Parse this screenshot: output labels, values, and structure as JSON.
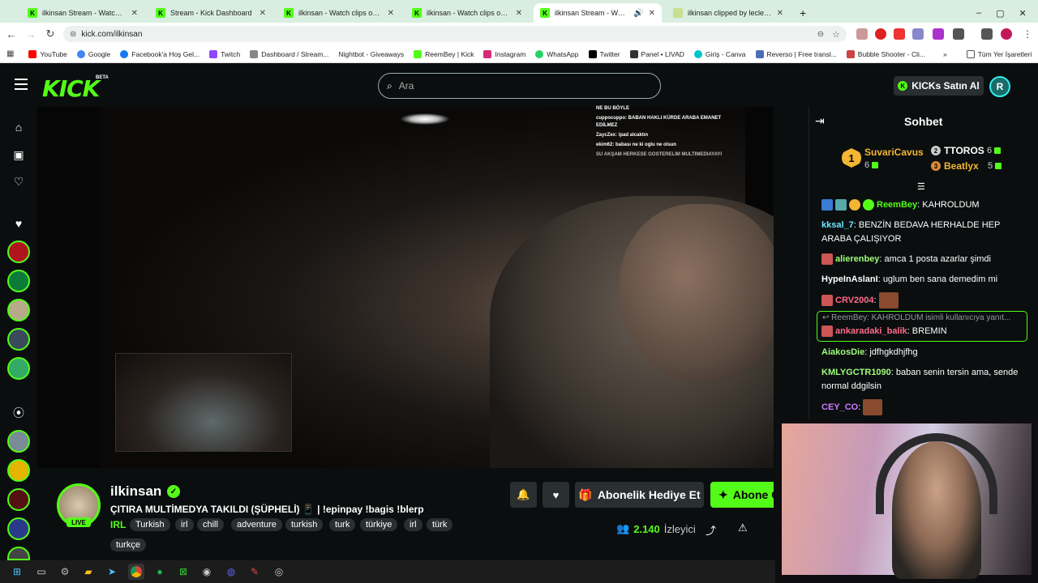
{
  "browser": {
    "tabs": [
      {
        "title": "ilkinsan Stream - Watch Live on Kick",
        "active": false
      },
      {
        "title": "Stream - Kick Dashboard",
        "active": false
      },
      {
        "title": "ilkinsan - Watch clips on Kick",
        "active": false
      },
      {
        "title": "ilkinsan - Watch clips on Kick",
        "active": false
      },
      {
        "title": "ilkinsan Stream - Watch Live on Kick",
        "active": true
      },
      {
        "title": "ilkinsan clipped by leclercurry",
        "active": false
      }
    ],
    "url": "kick.com/ilkinsan",
    "bookmarks": [
      "YouTube",
      "Google",
      "Facebook'a Hoş Gel...",
      "Twitch",
      "Dashboard / Stream...",
      "Nightbot - Giveaways",
      "ReemBey | Kick",
      "Instagram",
      "WhatsApp",
      "Twitter",
      "Panel • LIVAD",
      "Giriş - Canva",
      "Reverso | Free transl...",
      "Bubble Shooter - Cli..."
    ],
    "all_bookmarks": "Tüm Yer İşaretleri",
    "new_tab": "+",
    "chevron": "»"
  },
  "header": {
    "logo": "KICK",
    "logo_badge": "BETA",
    "search_placeholder": "Ara",
    "kicks_button": "KICKs Satın Al",
    "avatar_initial": "R"
  },
  "video_overlay_chat": [
    "NE BU BÖYLE",
    "cuppocuppo: BABAN HAKLI KÜRDE ARABA EMANET EDİLMEZ",
    "ZaycZex: ipad alcaktın",
    "ekim62: babası ne ki oglu ne olsun",
    "SU AKŞAM HERKESE GÖSTERELİM MULTİMEDİAYAYI"
  ],
  "channel": {
    "name": "ilkinsan",
    "live_label": "LIVE",
    "title": "ÇITIRA MULTİMEDYA TAKILDI (ŞÜPHELİ) 📱 | !epinpay !bagis !blerp",
    "category": "IRL",
    "tags": [
      "Turkish",
      "irl",
      "chill",
      "adventure",
      "turkish",
      "turk",
      "türkiye",
      "irl",
      "türk",
      "turkçe"
    ],
    "gift_button": "Abonelik Hediye Et",
    "subscribe_button": "Abone Ol",
    "viewer_count": "2.140",
    "viewer_label": "İzleyici"
  },
  "chat": {
    "title": "Sohbet",
    "leaderboard": [
      {
        "name": "SuvariCavus",
        "count": "6",
        "rank": "1",
        "color": "#f2b632"
      },
      {
        "name": "TTOROS",
        "count": "6",
        "rank": "2",
        "color": "#e6e6e6"
      },
      {
        "name": "Beatlyx",
        "count": "5",
        "rank": "3",
        "color": "#f2b632"
      }
    ],
    "messages": [
      {
        "user": "ReemBey",
        "text": "KAHROLDUM",
        "color": "#53fc18"
      },
      {
        "user": "kksal_7",
        "text": "BENZİN BEDAVA HERHALDE HEP ARABA ÇALIŞIYOR",
        "color": "#6ee7ff"
      },
      {
        "user": "alierenbey",
        "text": "amca 1 posta azarlar şimdi",
        "color": "#9dff7a"
      },
      {
        "user": "HypeInAslanI",
        "text": "uglum ben sana demedim mi",
        "color": "#ffffff"
      },
      {
        "user": "CRV2004",
        "text": "",
        "color": "#ff6b8a"
      },
      {
        "user": "ankaradaki_balik",
        "text": "BREMIN",
        "color": "#ff6b8a"
      },
      {
        "user": "AiakosDie",
        "text": "jdfhgkdhjfhg",
        "color": "#9dff7a"
      },
      {
        "user": "KMLYGCTR1090",
        "text": "baban senin tersin ama, sende normal ddgilsin",
        "color": "#9dff7a"
      },
      {
        "user": "CEY_CO",
        "text": "",
        "color": "#c77dff"
      }
    ],
    "reply_hint": "ReemBey: KAHROLDUM isimli kullanıcıya yanıt..."
  }
}
